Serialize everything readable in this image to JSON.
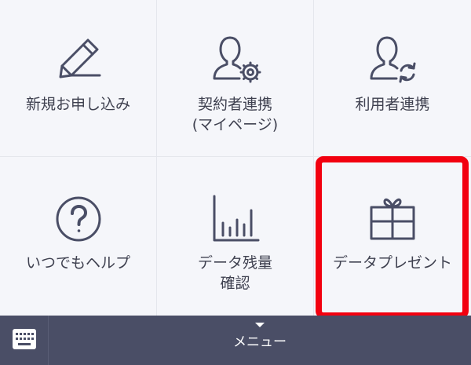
{
  "menu_grid": {
    "items": [
      {
        "label": "新規お申し込み",
        "icon": "pencil-icon"
      },
      {
        "label": "契約者連携\n(マイページ)",
        "icon": "user-gear-icon"
      },
      {
        "label": "利用者連携",
        "icon": "user-sync-icon"
      },
      {
        "label": "いつでもヘルプ",
        "icon": "help-circle-icon"
      },
      {
        "label": "データ残量\n確認",
        "icon": "bar-chart-icon"
      },
      {
        "label": "データプレゼント",
        "icon": "gift-box-icon"
      }
    ]
  },
  "highlight": {
    "color": "#f2000f",
    "target": "データプレゼント"
  },
  "bottom_bar": {
    "menu_label": "メニュー",
    "keyboard_icon": "keyboard-icon",
    "arrow_icon": "triangle-down-icon",
    "background": "#4a4e66"
  },
  "colors": {
    "icon_stroke": "#4a4e66",
    "label_text": "#3f4150",
    "background": "#f5f6fa"
  }
}
